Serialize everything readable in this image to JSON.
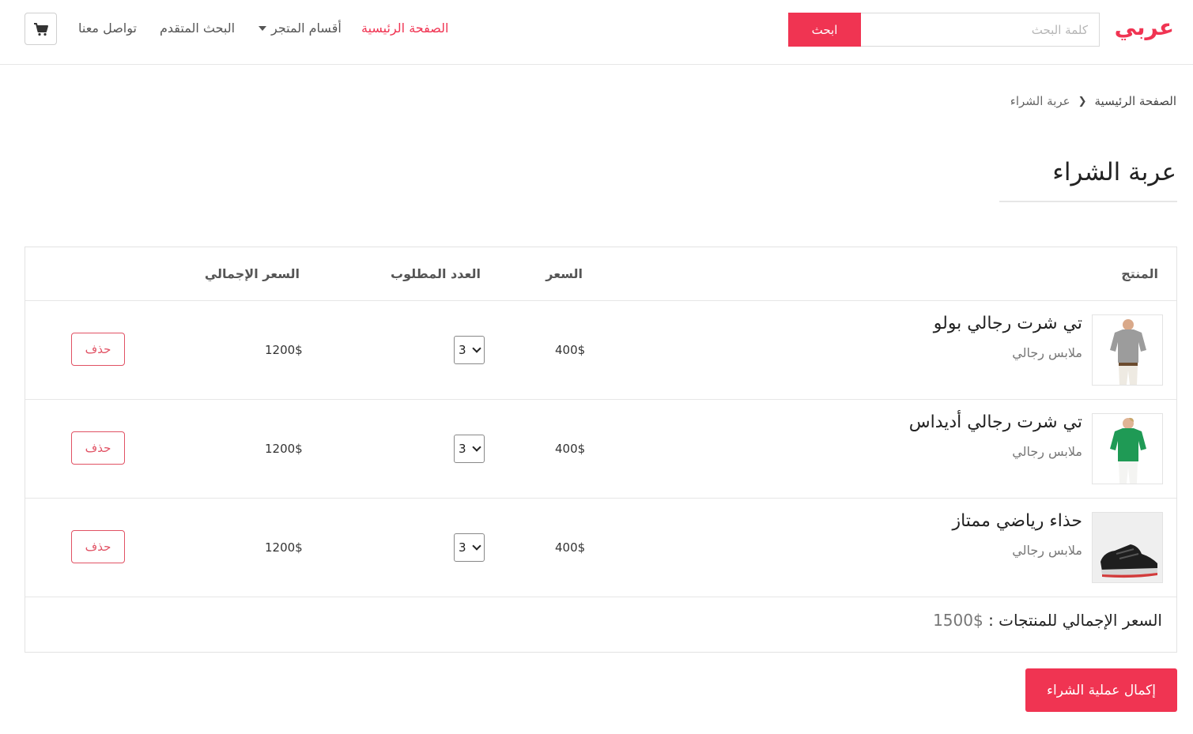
{
  "brand": {
    "logo_text": "عربي",
    "accent_color": "#f03452"
  },
  "search": {
    "placeholder": "كلمة البحث",
    "button_label": "ابحث"
  },
  "nav": {
    "home": "الصفحة الرئيسية",
    "sections": "أقسام المتجر",
    "advanced_search": "البحث المتقدم",
    "contact": "تواصل معنا",
    "cart_icon": "shopping-cart-icon"
  },
  "breadcrumb": {
    "home": "الصفحة الرئيسية",
    "current": "عربة الشراء"
  },
  "page_title": "عربة الشراء",
  "table": {
    "headers": {
      "product": "المنتج",
      "price": "السعر",
      "qty": "العدد المطلوب",
      "total": "السعر الإجمالي"
    },
    "rows": [
      {
        "name": "تي شرت رجالي بولو",
        "category": "ملابس رجالي",
        "price": "400$",
        "qty": "3",
        "total": "1200$",
        "delete": "حذف",
        "image": "grey-polo-shirt-image"
      },
      {
        "name": "تي شرت رجالي أديداس",
        "category": "ملابس رجالي",
        "price": "400$",
        "qty": "3",
        "total": "1200$",
        "delete": "حذف",
        "image": "green-polo-shirt-image"
      },
      {
        "name": "حذاء رياضي ممتاز",
        "category": "ملابس رجالي",
        "price": "400$",
        "qty": "3",
        "total": "1200$",
        "delete": "حذف",
        "image": "black-sneaker-image"
      }
    ]
  },
  "summary": {
    "label": "السعر الإجمالي للمنتجات :",
    "amount": "$1500"
  },
  "checkout_label": "إكمال عملية الشراء"
}
